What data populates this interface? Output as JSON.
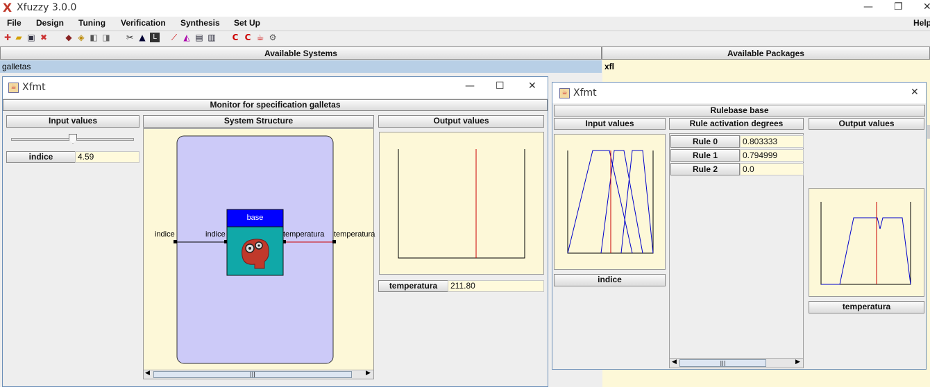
{
  "main": {
    "title": "Xfuzzy 3.0.0",
    "menu": [
      "File",
      "Design",
      "Tuning",
      "Verification",
      "Synthesis",
      "Set Up"
    ],
    "help": "Help",
    "available_systems_header": "Available Systems",
    "available_packages_header": "Available Packages",
    "system_item": "galletas",
    "package_item": "xfl",
    "controls": {
      "minimize": "—",
      "restore": "❐",
      "close": "✕"
    }
  },
  "monitor": {
    "window_title": "Xfmt",
    "header": "Monitor for specification galletas",
    "input_values_label": "Input values",
    "system_structure_label": "System Structure",
    "output_values_label": "Output values",
    "input_name": "indice",
    "input_value": "4.59",
    "slider_fraction": 0.5,
    "output_name": "temperatura",
    "output_value": "211.80",
    "rulebase_name": "base",
    "left_in_label": "indice",
    "inner_in_label": "indice",
    "inner_out_label": "temperatura",
    "right_out_label": "temperatura",
    "controls": {
      "minimize": "—",
      "maximize": "☐",
      "close": "✕"
    }
  },
  "rulebase": {
    "window_title": "Xfmt",
    "header": "Rulebase base",
    "input_values_label": "Input values",
    "rule_activation_label": "Rule activation degrees",
    "output_values_label": "Output values",
    "input_button": "indice",
    "output_button": "temperatura",
    "rules": [
      {
        "name": "Rule 0",
        "value": "0.803333"
      },
      {
        "name": "Rule 1",
        "value": "0.794999"
      },
      {
        "name": "Rule 2",
        "value": "0.0"
      }
    ],
    "controls": {
      "close": "✕"
    }
  },
  "colors": {
    "background": "#eeeeee",
    "plot_bg": "#fdf8d8",
    "system_bg": "#cccaf8",
    "rulebase_header": "#0000ff",
    "rulebase_body": "#10a8a8",
    "curve": "#0000cc",
    "marker": "#cc0000",
    "selection": "#b8cfe6"
  }
}
